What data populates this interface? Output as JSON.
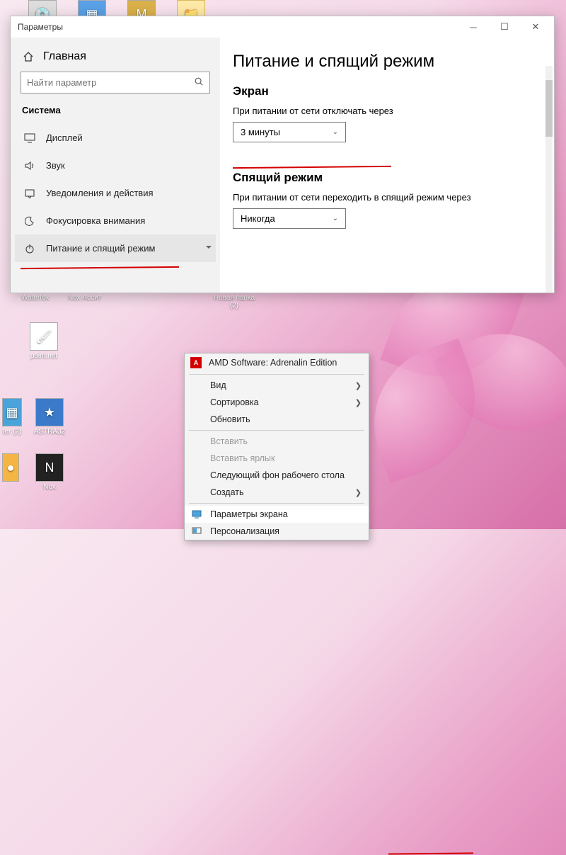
{
  "desktop": {
    "icons": [
      {
        "label": "Waterfox"
      },
      {
        "label": "Nox Ассит"
      },
      {
        "label": "paint.net"
      },
      {
        "label": "ter (2)"
      },
      {
        "label": "ASTRA32"
      },
      {
        "label": "Nox"
      }
    ],
    "topIcons": [
      {
        "label": ""
      },
      {
        "label": ""
      },
      {
        "label": ""
      },
      {
        "label": ""
      }
    ],
    "folderLabel": "Новая папка (2)"
  },
  "settings": {
    "windowTitle": "Параметры",
    "homeLabel": "Главная",
    "searchPlaceholder": "Найти параметр",
    "sectionLabel": "Система",
    "nav": [
      {
        "icon": "display",
        "label": "Дисплей"
      },
      {
        "icon": "sound",
        "label": "Звук"
      },
      {
        "icon": "notify",
        "label": "Уведомления и действия"
      },
      {
        "icon": "focus",
        "label": "Фокусировка внимания"
      },
      {
        "icon": "power",
        "label": "Питание и спящий режим"
      }
    ],
    "pageTitle": "Питание и спящий режим",
    "screen": {
      "heading": "Экран",
      "label": "При питании от сети отключать через",
      "value": "3 минуты"
    },
    "sleep": {
      "heading": "Спящий режим",
      "label": "При питании от сети переходить в спящий режим через",
      "value": "Никогда"
    }
  },
  "contextMenu": {
    "items": [
      {
        "kind": "item",
        "icon": "amd",
        "label": "AMD Software: Adrenalin Edition"
      },
      {
        "kind": "sep"
      },
      {
        "kind": "item",
        "label": "Вид",
        "submenu": true
      },
      {
        "kind": "item",
        "label": "Сортировка",
        "submenu": true
      },
      {
        "kind": "item",
        "label": "Обновить"
      },
      {
        "kind": "sep"
      },
      {
        "kind": "item",
        "label": "Вставить",
        "disabled": true
      },
      {
        "kind": "item",
        "label": "Вставить ярлык",
        "disabled": true
      },
      {
        "kind": "item",
        "label": "Следующий фон рабочего стола"
      },
      {
        "kind": "item",
        "label": "Создать",
        "submenu": true
      },
      {
        "kind": "sep"
      },
      {
        "kind": "item",
        "icon": "screen",
        "label": "Параметры экрана",
        "selected": true
      },
      {
        "kind": "item",
        "icon": "pers",
        "label": "Персонализация"
      }
    ]
  }
}
